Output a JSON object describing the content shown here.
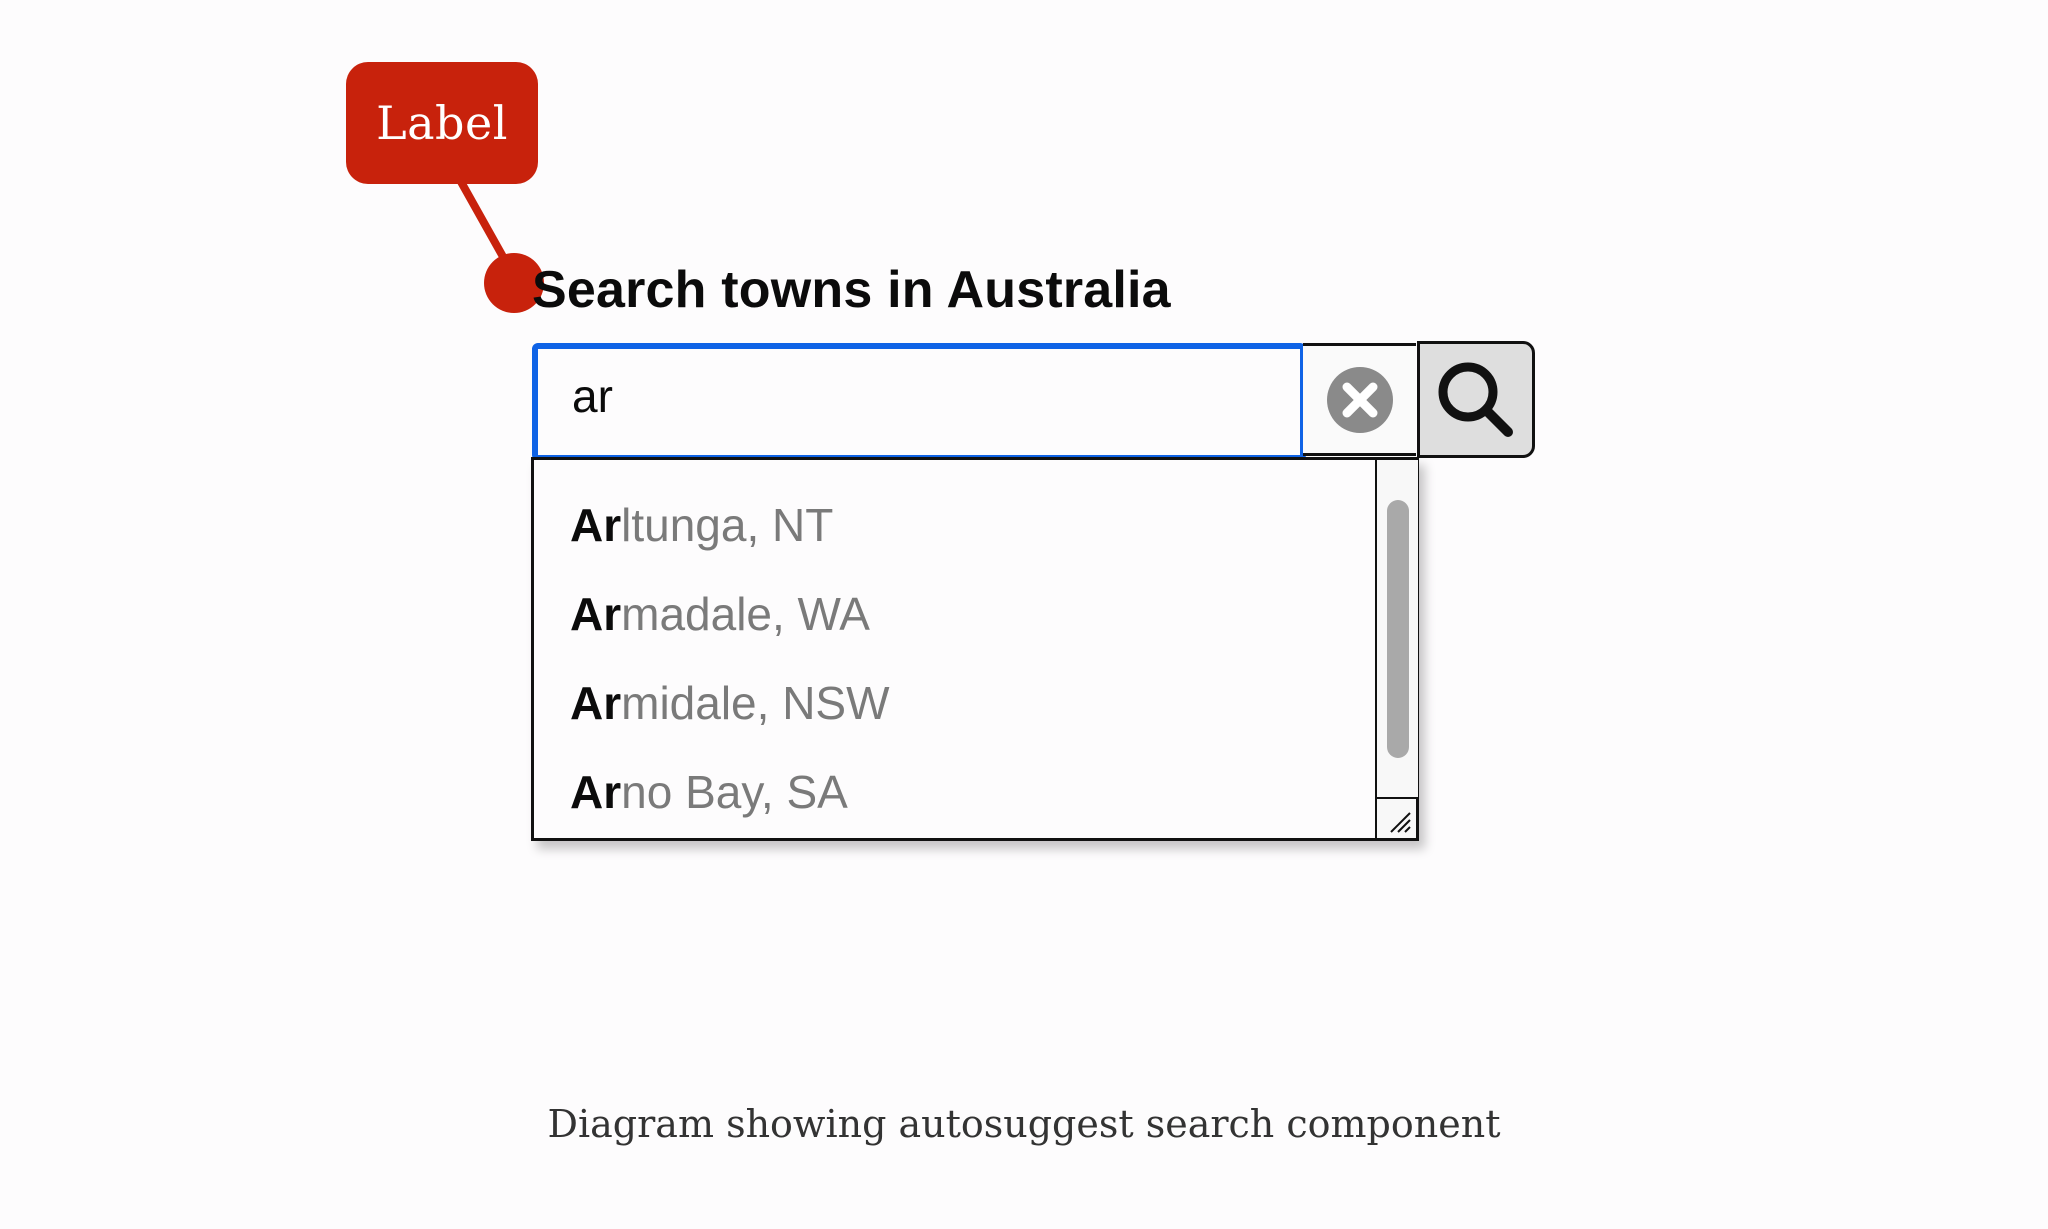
{
  "callout": {
    "label": "Label",
    "color": "#c8220c"
  },
  "search": {
    "heading": "Search towns in Australia",
    "input_value": "ar",
    "focus_color": "#0f63e6",
    "clear_icon": "clear-icon",
    "search_icon": "search-icon"
  },
  "suggestions": [
    {
      "match": "Ar",
      "rest": "ltunga, NT"
    },
    {
      "match": "Ar",
      "rest": "madale, WA"
    },
    {
      "match": "Ar",
      "rest": "midale, NSW"
    },
    {
      "match": "Ar",
      "rest": "no Bay, SA"
    }
  ],
  "caption": "Diagram showing autosuggest search component"
}
